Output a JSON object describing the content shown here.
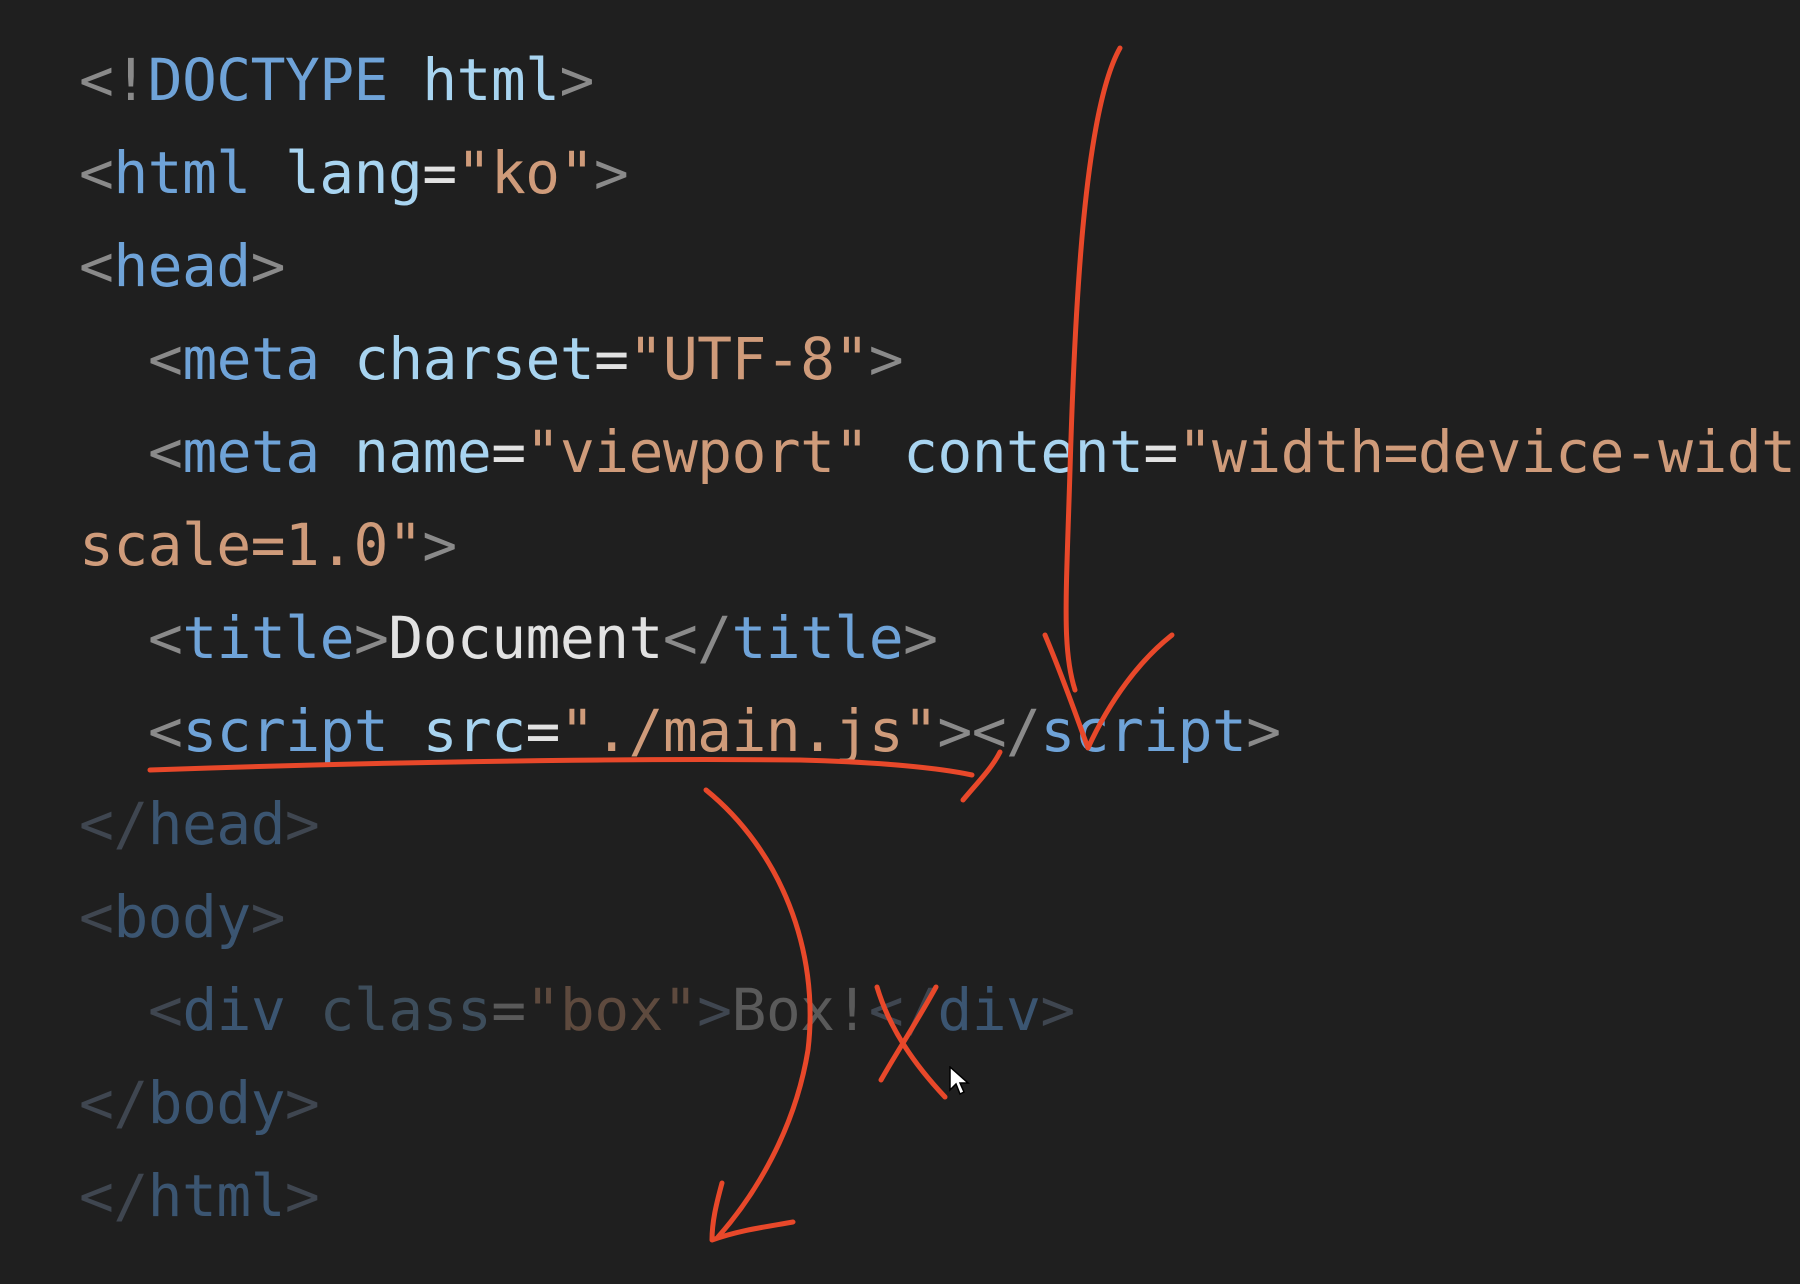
{
  "code": {
    "doctype": {
      "open": "<!",
      "keyword": "DOCTYPE",
      "name": "html",
      "close": ">"
    },
    "html_open": {
      "open": "<",
      "tag": "html",
      "attr": "lang",
      "eq": "=",
      "value": "\"ko\"",
      "close": ">"
    },
    "head_open": {
      "open": "<",
      "tag": "head",
      "close": ">"
    },
    "meta_charset": {
      "open": "<",
      "tag": "meta",
      "attr": "charset",
      "eq": "=",
      "value": "\"UTF-8\"",
      "close": ">"
    },
    "meta_viewport": {
      "open": "<",
      "tag": "meta",
      "attr1": "name",
      "eq1": "=",
      "value1": "\"viewport\"",
      "attr2": "content",
      "eq2": "=",
      "value2": "\"width=device-widt",
      "wrap_value": "scale=1.0\"",
      "wrap_close": ">"
    },
    "title": {
      "open": "<",
      "tag": "title",
      "mid": ">",
      "text": "Document",
      "close_open": "</",
      "close_tag": "title",
      "close": ">"
    },
    "script": {
      "open": "<",
      "tag": "script",
      "attr": "src",
      "eq": "=",
      "value": "\"./main.js\"",
      "mid": "></",
      "close_tag": "script",
      "close": ">"
    },
    "head_close": {
      "open": "</",
      "tag": "head",
      "close": ">"
    },
    "body_open": {
      "open": "<",
      "tag": "body",
      "close": ">"
    },
    "div": {
      "open": "<",
      "tag": "div",
      "attr": "class",
      "eq": "=",
      "value": "\"box\"",
      "mid": ">",
      "text": "Box!",
      "close_open": "</",
      "close_tag": "div",
      "close": ">"
    },
    "body_close": {
      "open": "</",
      "tag": "body",
      "close": ">"
    },
    "html_close": {
      "open": "</",
      "tag": "html",
      "close": ">"
    }
  },
  "annotation_color": "#e8482a",
  "icons": {
    "cursor": "mouse-pointer-icon"
  }
}
